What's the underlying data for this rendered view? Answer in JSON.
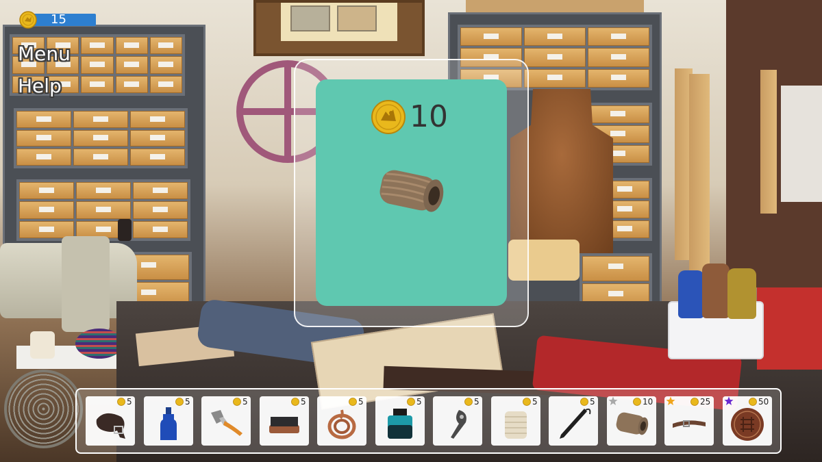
{
  "hud": {
    "coins": "15",
    "menu_label": "Menu",
    "help_label": "Help"
  },
  "popup": {
    "price": "10",
    "item_icon": "twine-spool-icon",
    "card_color": "#5fc8b0"
  },
  "inventory": {
    "slots": [
      {
        "icon": "belt-icon",
        "price": "5",
        "star": ""
      },
      {
        "icon": "blue-bottle-icon",
        "price": "5",
        "star": ""
      },
      {
        "icon": "paintbrush-icon",
        "price": "5",
        "star": ""
      },
      {
        "icon": "scrub-brush-icon",
        "price": "5",
        "star": ""
      },
      {
        "icon": "leather-cord-icon",
        "price": "5",
        "star": ""
      },
      {
        "icon": "ink-bottle-icon",
        "price": "5",
        "star": ""
      },
      {
        "icon": "leather-knife-icon",
        "price": "5",
        "star": ""
      },
      {
        "icon": "white-thread-spool-icon",
        "price": "5",
        "star": ""
      },
      {
        "icon": "black-awl-icon",
        "price": "5",
        "star": ""
      },
      {
        "icon": "twine-spool-icon",
        "price": "10",
        "star": "silver"
      },
      {
        "icon": "leather-strap-icon",
        "price": "25",
        "star": "gold"
      },
      {
        "icon": "leather-coaster-icon",
        "price": "50",
        "star": "purple"
      }
    ]
  },
  "colors": {
    "hud_bar": "#2d7fd0",
    "coin_gold": "#e9b81c",
    "star_silver": "#a9a9a9",
    "star_gold": "#f0a51c",
    "star_purple": "#6a2ad1"
  }
}
